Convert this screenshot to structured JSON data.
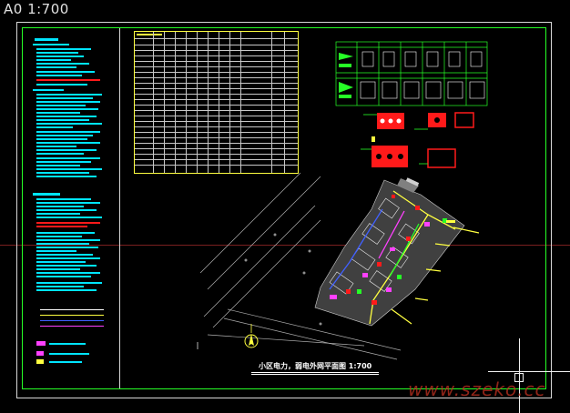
{
  "viewport": {
    "scale_label": "A0 1:700"
  },
  "drawing": {
    "title": "小区电力，弱电外网平面图 1:700"
  },
  "watermark": {
    "text": "www.szeko.cc"
  },
  "colors": {
    "background": "#000000",
    "frame": "#d8d8d8",
    "inner_frame": "#26ff26",
    "notes_text": "#00e5ff",
    "table_border": "#ffff40",
    "crosshair": "#7a1f1f",
    "red_elements": "#ff1a1a",
    "magenta_elements": "#ff40ff",
    "yellow_elements": "#ffff40"
  }
}
